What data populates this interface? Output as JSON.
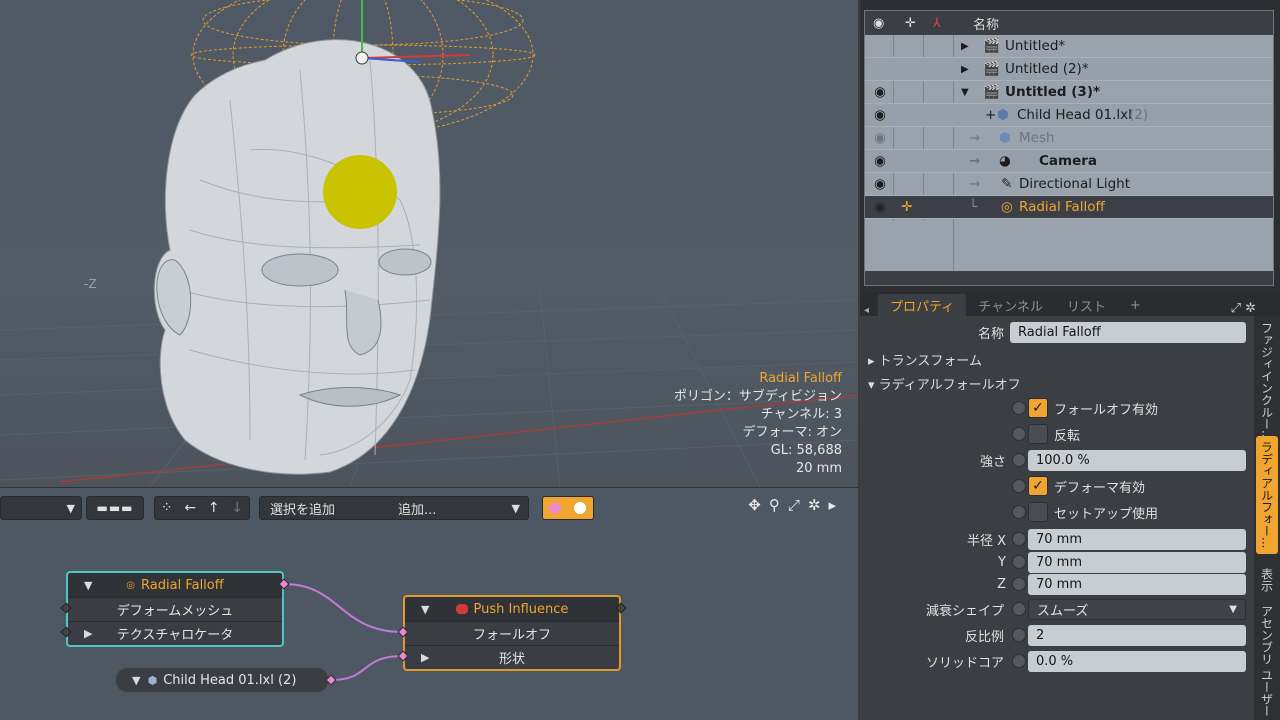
{
  "viewport": {
    "info": [
      "Radial Falloff",
      "ポリゴン：サブディビジョン",
      "チャンネル: 3",
      "デフォーマ: オン",
      "GL: 58,688",
      "20 mm"
    ],
    "axis_label": "-Z"
  },
  "schematic": {
    "toolbar": {
      "add_selection": "選択を追加",
      "add": "追加..."
    },
    "nodes": {
      "radial": {
        "title": "Radial Falloff",
        "ports": [
          "デフォームメッシュ",
          "テクスチャロケータ"
        ]
      },
      "push": {
        "title": "Push Influence",
        "ports": [
          "フォールオフ",
          "形状"
        ]
      },
      "child": {
        "title": "Child Head 01.lxl (2)"
      }
    }
  },
  "outliner": {
    "header_name": "名称",
    "items": [
      {
        "label": "Untitled*",
        "depth": 0
      },
      {
        "label": "Untitled (2)*",
        "depth": 0
      },
      {
        "label": "Untitled (3)*",
        "depth": 0
      },
      {
        "label": "Child Head 01.lxl",
        "suffix": "(2)",
        "depth": 1
      },
      {
        "label": "Mesh",
        "depth": 2
      },
      {
        "label": "Camera",
        "depth": 2
      },
      {
        "label": "Directional Light",
        "depth": 2
      },
      {
        "label": "Radial Falloff",
        "depth": 2
      }
    ]
  },
  "tabs": [
    "プロパティ",
    "チャンネル",
    "リスト",
    "+"
  ],
  "properties": {
    "name_label": "名称",
    "name_value": "Radial Falloff",
    "section_transform": "トランスフォーム",
    "section_radial": "ラディアルフォールオフ",
    "falloff_enabled": "フォールオフ有効",
    "invert": "反転",
    "strength_label": "強さ",
    "strength_value": "100.0 %",
    "deformer_enabled": "デフォーマ有効",
    "setup_use": "セットアップ使用",
    "radius_label": "半径 X",
    "y_label": "Y",
    "z_label": "Z",
    "radius_x": "70 mm",
    "radius_y": "70 mm",
    "radius_z": "70 mm",
    "shape_label": "減衰シェイプ",
    "shape_value": "スムーズ",
    "inverse_label": "反比例",
    "inverse_value": "2",
    "core_label": "ソリッドコア",
    "core_value": "0.0 %"
  },
  "vtabs": [
    "ファジィインクルー...",
    "ラディアルフォー...",
    "表示",
    "アセンブリ",
    "ユーザー"
  ],
  "colors": {
    "accent": "#f0a530",
    "viewport_bg": "#525b66",
    "outliner_bg": "#9aa3ac"
  }
}
